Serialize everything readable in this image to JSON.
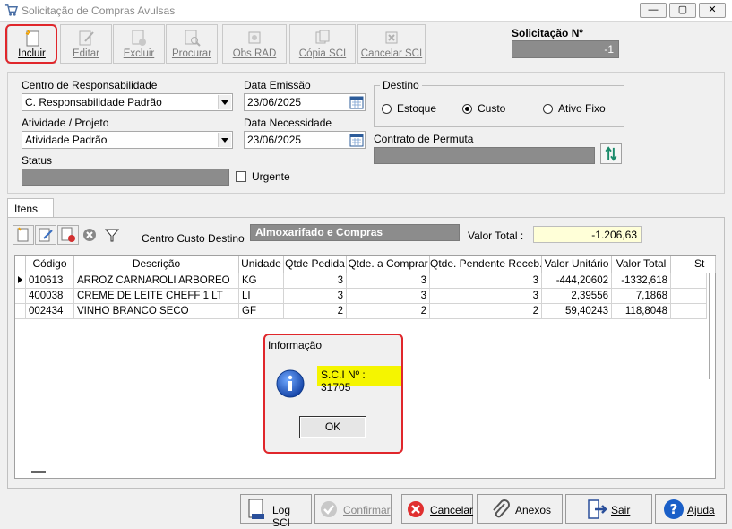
{
  "window": {
    "title": "Solicitação de Compras Avulsas"
  },
  "toolbar": {
    "incluir": "Incluir",
    "editar": "Editar",
    "excluir": "Excluir",
    "procurar": "Procurar",
    "obs_rad": "Obs RAD",
    "copia_sci": "Cópia SCI",
    "cancelar_sci": "Cancelar SCI"
  },
  "solicitacao": {
    "label": "Solicitação Nº",
    "value": "-1"
  },
  "form": {
    "centro_label": "Centro de Responsabilidade",
    "centro_value": "C. Responsabilidade Padrão",
    "atividade_label": "Atividade / Projeto",
    "atividade_value": "Atividade Padrão",
    "status_label": "Status",
    "data_emissao_label": "Data Emissão",
    "data_emissao_value": "23/06/2025",
    "data_necessidade_label": "Data Necessidade",
    "data_necessidade_value": "23/06/2025",
    "urgente_label": "Urgente",
    "destino_label": "Destino",
    "destino_options": [
      "Estoque",
      "Custo",
      "Ativo Fixo"
    ],
    "destino_selected": "Custo",
    "contrato_label": "Contrato de Permuta"
  },
  "tab": {
    "itens": "Itens"
  },
  "items_bar": {
    "centro_custo_label": "Centro Custo Destino",
    "centro_custo_value": "Almoxarifado e Compras",
    "valor_total_label": "Valor Total :",
    "valor_total_value": "-1.206,63"
  },
  "table": {
    "columns": [
      "Código",
      "Descrição",
      "Unidade",
      "Qtde Pedida",
      "Qtde. a Comprar",
      "Qtde. Pendente Receb.",
      "Valor Unitário",
      "Valor Total",
      "St"
    ],
    "rows": [
      [
        "010613",
        "ARROZ  CARNAROLI  ARBOREO",
        "KG",
        "3",
        "3",
        "3",
        "-444,20602",
        "-1332,618"
      ],
      [
        "400038",
        "CREME DE LEITE CHEFF 1 LT",
        "LI",
        "3",
        "3",
        "3",
        "2,39556",
        "7,1868"
      ],
      [
        "002434",
        "VINHO BRANCO SECO",
        "GF",
        "2",
        "2",
        "2",
        "59,40243",
        "118,8048"
      ]
    ]
  },
  "dialog": {
    "title": "Informação",
    "message": "S.C.I Nº : 31705",
    "ok": "OK"
  },
  "bottom": {
    "log_sci": "Log SCI",
    "confirmar": "Confirmar",
    "cancelar": "Cancelar",
    "anexos": "Anexos",
    "sair": "Sair",
    "ajuda": "Ajuda"
  },
  "colors": {
    "highlight": "#e0262b",
    "dialog_message_bg": "#f5f500",
    "info_icon": "#1a5fc8",
    "cancel_icon": "#e03030",
    "help_icon": "#1a5fc8"
  }
}
